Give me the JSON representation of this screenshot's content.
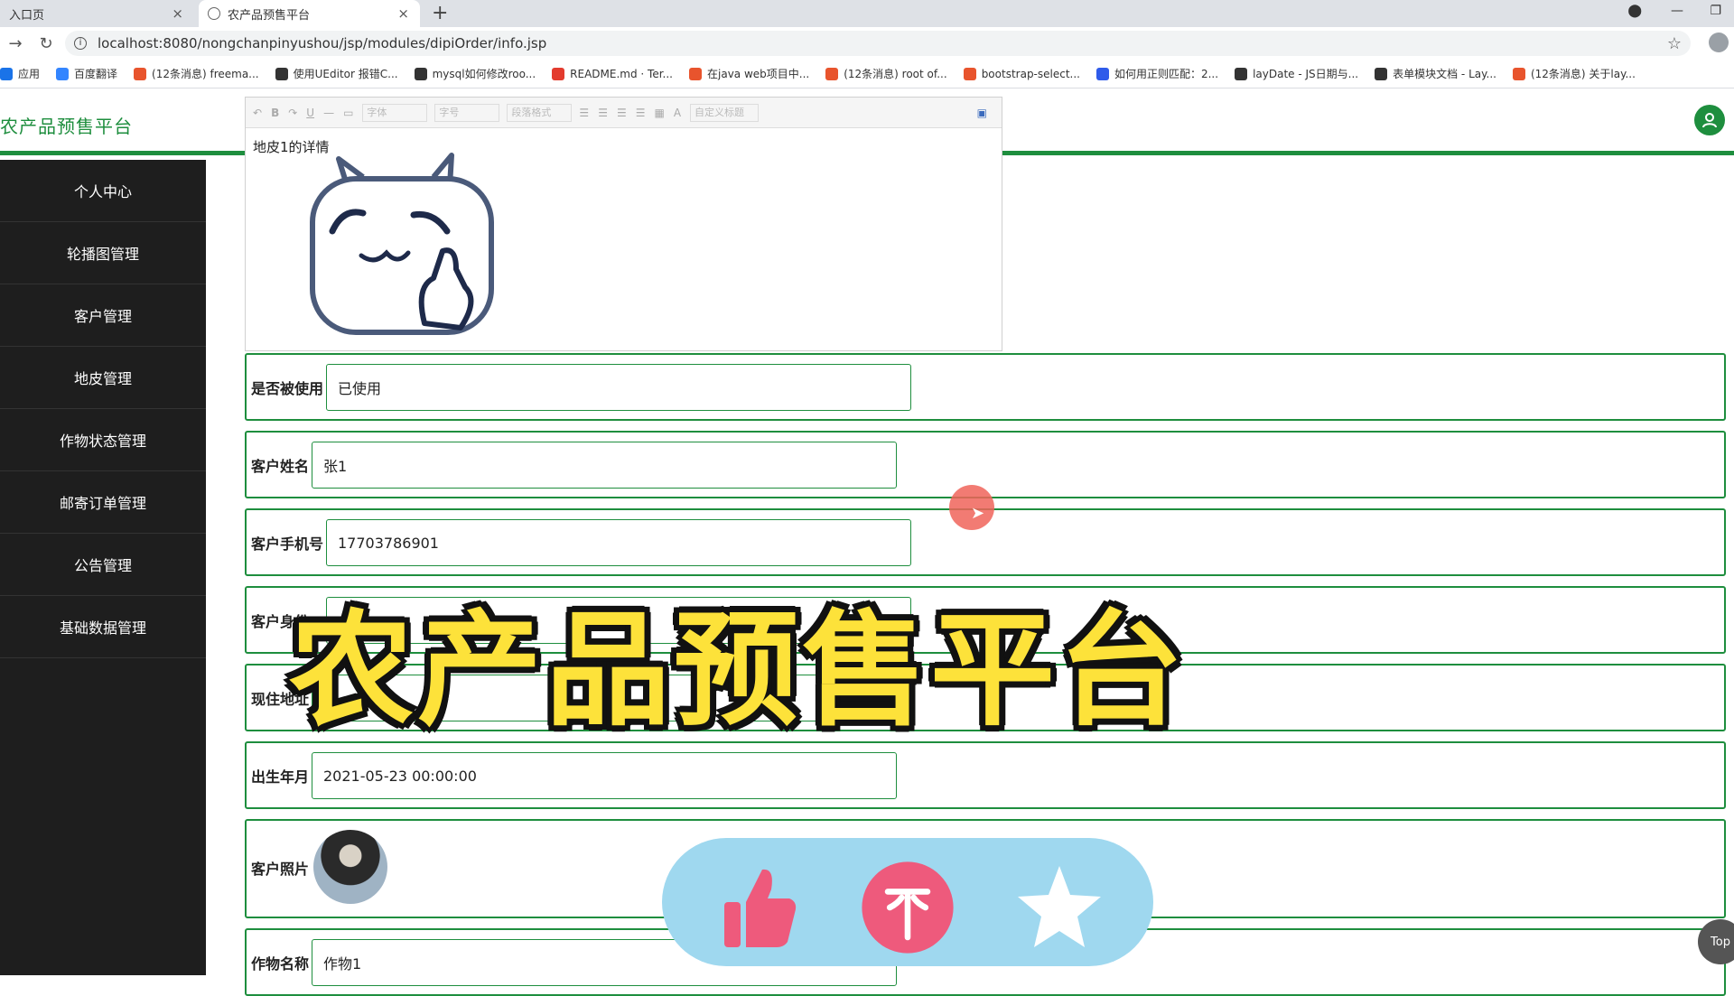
{
  "browser": {
    "tabs": [
      {
        "title": "入口页",
        "close": "×"
      },
      {
        "title": "农产品预售平台",
        "close": "×"
      }
    ],
    "new_tab": "+",
    "url": "localhost:8080/nongchanpinyushou/jsp/modules/dipiOrder/info.jsp",
    "bookmarks": [
      {
        "label": "应用",
        "color": "#1a73e8"
      },
      {
        "label": "百度翻译",
        "color": "#3385ff"
      },
      {
        "label": "(12条消息) freema...",
        "color": "#e8542d"
      },
      {
        "label": "使用UEditor 报错C...",
        "color": "#333333"
      },
      {
        "label": "mysql如何修改roo...",
        "color": "#333333"
      },
      {
        "label": "README.md · Ter...",
        "color": "#e33b2e"
      },
      {
        "label": "在java web项目中...",
        "color": "#e8542d"
      },
      {
        "label": "(12条消息) root of...",
        "color": "#e8542d"
      },
      {
        "label": "bootstrap-select...",
        "color": "#e8542d"
      },
      {
        "label": "如何用正则匹配：2...",
        "color": "#2f5bea"
      },
      {
        "label": "layDate - JS日期与...",
        "color": "#333333"
      },
      {
        "label": "表单模块文档 - Lay...",
        "color": "#333333"
      },
      {
        "label": "(12条消息) 关于lay...",
        "color": "#e8542d"
      }
    ]
  },
  "app": {
    "title": "农产品预售平台",
    "accent": "#1e8e3e"
  },
  "sidebar": {
    "items": [
      {
        "label": "个人中心"
      },
      {
        "label": "轮播图管理"
      },
      {
        "label": "客户管理"
      },
      {
        "label": "地皮管理"
      },
      {
        "label": "作物状态管理"
      },
      {
        "label": "邮寄订单管理"
      },
      {
        "label": "公告管理"
      },
      {
        "label": "基础数据管理"
      }
    ]
  },
  "editor": {
    "font_select": "字体",
    "size_select": "字号",
    "para_select": "段落格式",
    "custom_title": "自定义标题",
    "content_text": "地皮1的详情"
  },
  "form": {
    "fields": [
      {
        "label": "是否被使用",
        "value": "已使用"
      },
      {
        "label": "客户姓名",
        "value": "张1"
      },
      {
        "label": "客户手机号",
        "value": "17703786901"
      },
      {
        "label": "客户身份",
        "value": ""
      },
      {
        "label": "现住地址",
        "value": "地"
      },
      {
        "label": "出生年月",
        "value": "2021-05-23 00:00:00"
      },
      {
        "label": "客户照片",
        "value": ""
      },
      {
        "label": "作物名称",
        "value": "作物1"
      }
    ]
  },
  "overlay": {
    "big_title": "农产品预售平台",
    "top_button": "Top"
  },
  "icons": [
    "back-icon",
    "refresh-icon",
    "info-icon",
    "star-icon",
    "user-icon",
    "thumbs-up-icon",
    "coin-icon",
    "favorite-star-icon"
  ]
}
